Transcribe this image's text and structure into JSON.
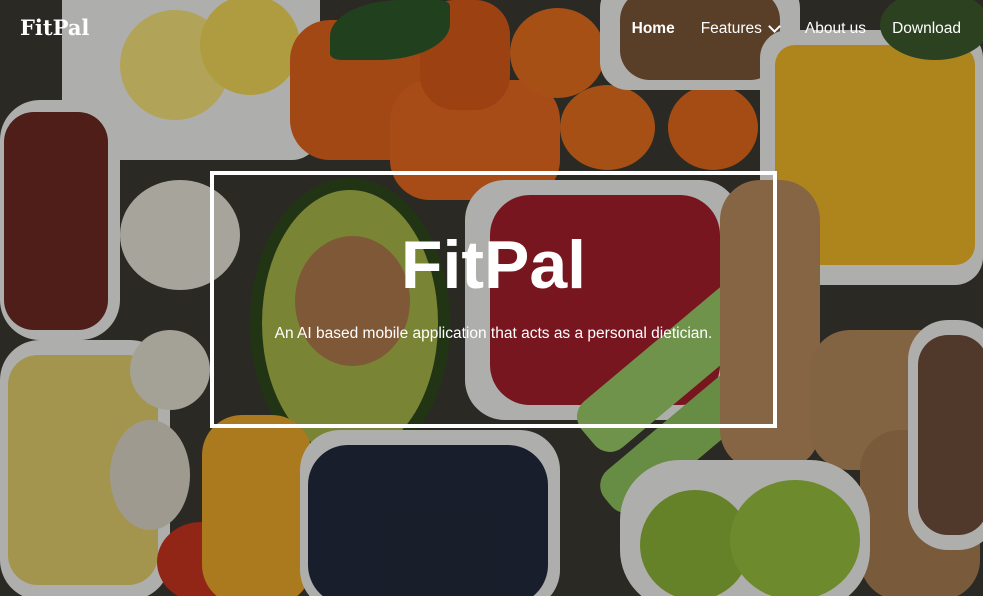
{
  "brand": "FitPal",
  "nav": {
    "home": "Home",
    "features": "Features",
    "about": "About us",
    "download": "Download"
  },
  "hero": {
    "title": "FitPal",
    "tagline": "An AI based mobile application that acts as a personal dietician."
  },
  "colors": {
    "text": "#ffffff",
    "overlay": "rgba(0,0,0,0.28)"
  }
}
